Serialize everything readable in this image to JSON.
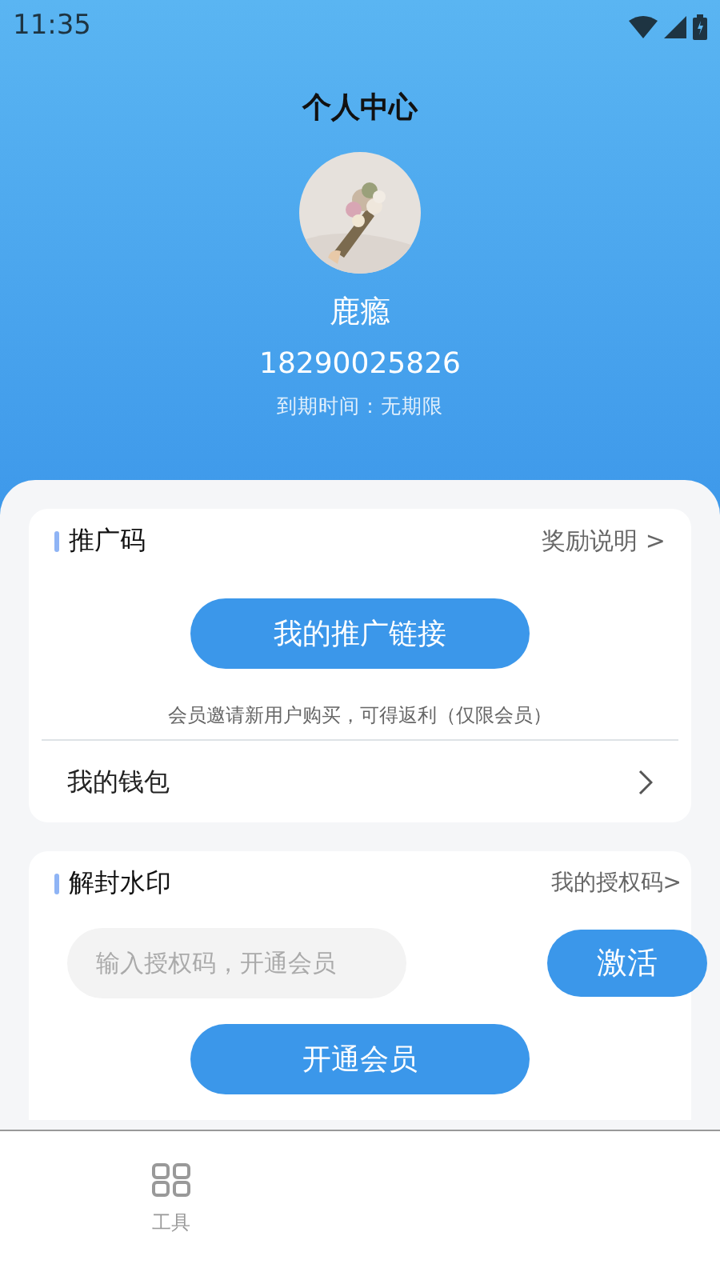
{
  "status_bar": {
    "time": "11:35"
  },
  "header": {
    "title": "个人中心",
    "name": "鹿瘾",
    "phone": "18290025826",
    "expiry": "到期时间：无期限"
  },
  "promo_card": {
    "title": "推广码",
    "link": "奖励说明 >",
    "button": "我的推广链接",
    "note": "会员邀请新用户购买，可得返利（仅限会员）",
    "wallet": "我的钱包"
  },
  "watermark_card": {
    "title": "解封水印",
    "link": "我的授权码>",
    "input": {
      "placeholder": "输入授权码，开通会员"
    },
    "activate": "激活",
    "member_button": "开通会员"
  },
  "bottom_nav": [
    {
      "label": "工具"
    }
  ]
}
